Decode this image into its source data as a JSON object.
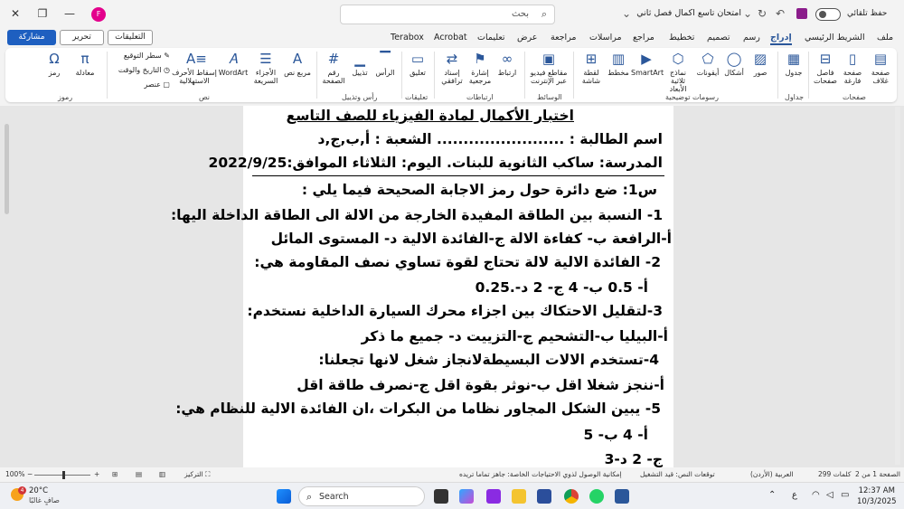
{
  "titlebar": {
    "autosave_label": "حفظ تلقائي",
    "doc_title": "امتحان تاسع اكمال فصل ثاني",
    "search_placeholder": "بحث",
    "avatar_initial": "F"
  },
  "tabs": [
    "ملف",
    "الشريط الرئيسي",
    "إدراج",
    "رسم",
    "تصميم",
    "تخطيط",
    "مراجع",
    "مراسلات",
    "مراجعة",
    "عرض",
    "تعليمات",
    "Acrobat",
    "Terabox"
  ],
  "active_tab": "إدراج",
  "actions": {
    "comments": "التعليقات",
    "edit": "تحرير",
    "share": "مشاركة"
  },
  "ribbon": {
    "pages": [
      "صفحة غلاف",
      "صفحة فارغة",
      "فاصل صفحات"
    ],
    "pages_group": "صفحات",
    "table": "جدول",
    "tables_group": "جداول",
    "illustrations": [
      "صور",
      "أشكال",
      "أيقونات",
      "نماذج ثلاثية الأبعاد",
      "SmartArt",
      "مخطط",
      "لقطة شاشة"
    ],
    "illustrations_group": "رسومات توضيحية",
    "media": "مقاطع فيديو عبر الإنترنت",
    "media_group": "الوسائط",
    "links": [
      "ارتباط",
      "إشارة مرجعية",
      "إسناد ترافقي"
    ],
    "links_group": "ارتباطات",
    "comment": "تعليق",
    "comments_group": "تعليقات",
    "header_footer": [
      "الرأس",
      "تذييل",
      "رقم الصفحة"
    ],
    "header_footer_group": "رأس وتذييل",
    "text_items": [
      "مربع نص",
      "الأجزاء السريعة",
      "WordArt",
      "إسقاط الأحرف الاستهلالية"
    ],
    "text_small": [
      "سطر التوقيع",
      "التاريخ والوقت",
      "عنصر"
    ],
    "text_group": "نص",
    "symbols": [
      "معادلة",
      "رمز"
    ],
    "symbols_group": "رموز"
  },
  "document": {
    "lines": [
      "اختبار الأكمال لمادة الفيزياء للصف التاسع",
      "اسم الطالبة : ........................      الشعبة : أ,ب,ج,د",
      "المدرسة: ساكب الثانوية للبنات.  اليوم: الثلاثاء  الموافق:2022/9/25",
      "س1: ضع دائرة حول رمز الاجابة الصحيحة فيما يلي :",
      "1-  النسبة بين الطاقة المفيدة الخارجة من الالة الى الطاقة الداخلة اليها:",
      "أ-الرافعة       ب- كفاءة الالة       ج-الفائدة الالية       د- المستوى المائل",
      "2-  الفائدة الالية لالة تحتاج لقوة تساوي نصف المقاومة هي:",
      "أ-  0.5       ب-  4            ج-  2                د-.0.25",
      "3-لتقليل الاحتكاك بين اجزاء محرك السيارة الداخلية نستخدم:",
      "أ-البيليا       ب-التشحيم       ج-التزييت             د- جميع ما ذكر",
      "4-تستخدم الالات البسيطةلانجاز شغل لانها تجعلنا:",
      "أ-ننجز شغلا اقل       ب-نوثر بقوة اقل       ج-نصرف طاقة اقل",
      "5- يبين الشكل المجاور نظاما من البكرات ،ان الفائدة الالية للنظام هي:",
      "أ-     4          ب-  5",
      "ج-  2         د-3"
    ]
  },
  "statusbar": {
    "page": "الصفحة 1 من 2",
    "words": "299 كلمات",
    "language": "العربية (الأردن)",
    "predictions": "توقعات النص: قيد التشغيل",
    "accessibility": "إمكانية الوصول لذوي الاحتياجات الخاصة: جاهز تماما تريده",
    "focus": "التركيز",
    "zoom": "100%"
  },
  "taskbar": {
    "temp": "20°C",
    "weather_desc": "صافٍ غالبًا",
    "search": "Search",
    "time": "12:37 AM",
    "date": "10/3/2025",
    "notif_count": "4",
    "lang": "ع"
  }
}
